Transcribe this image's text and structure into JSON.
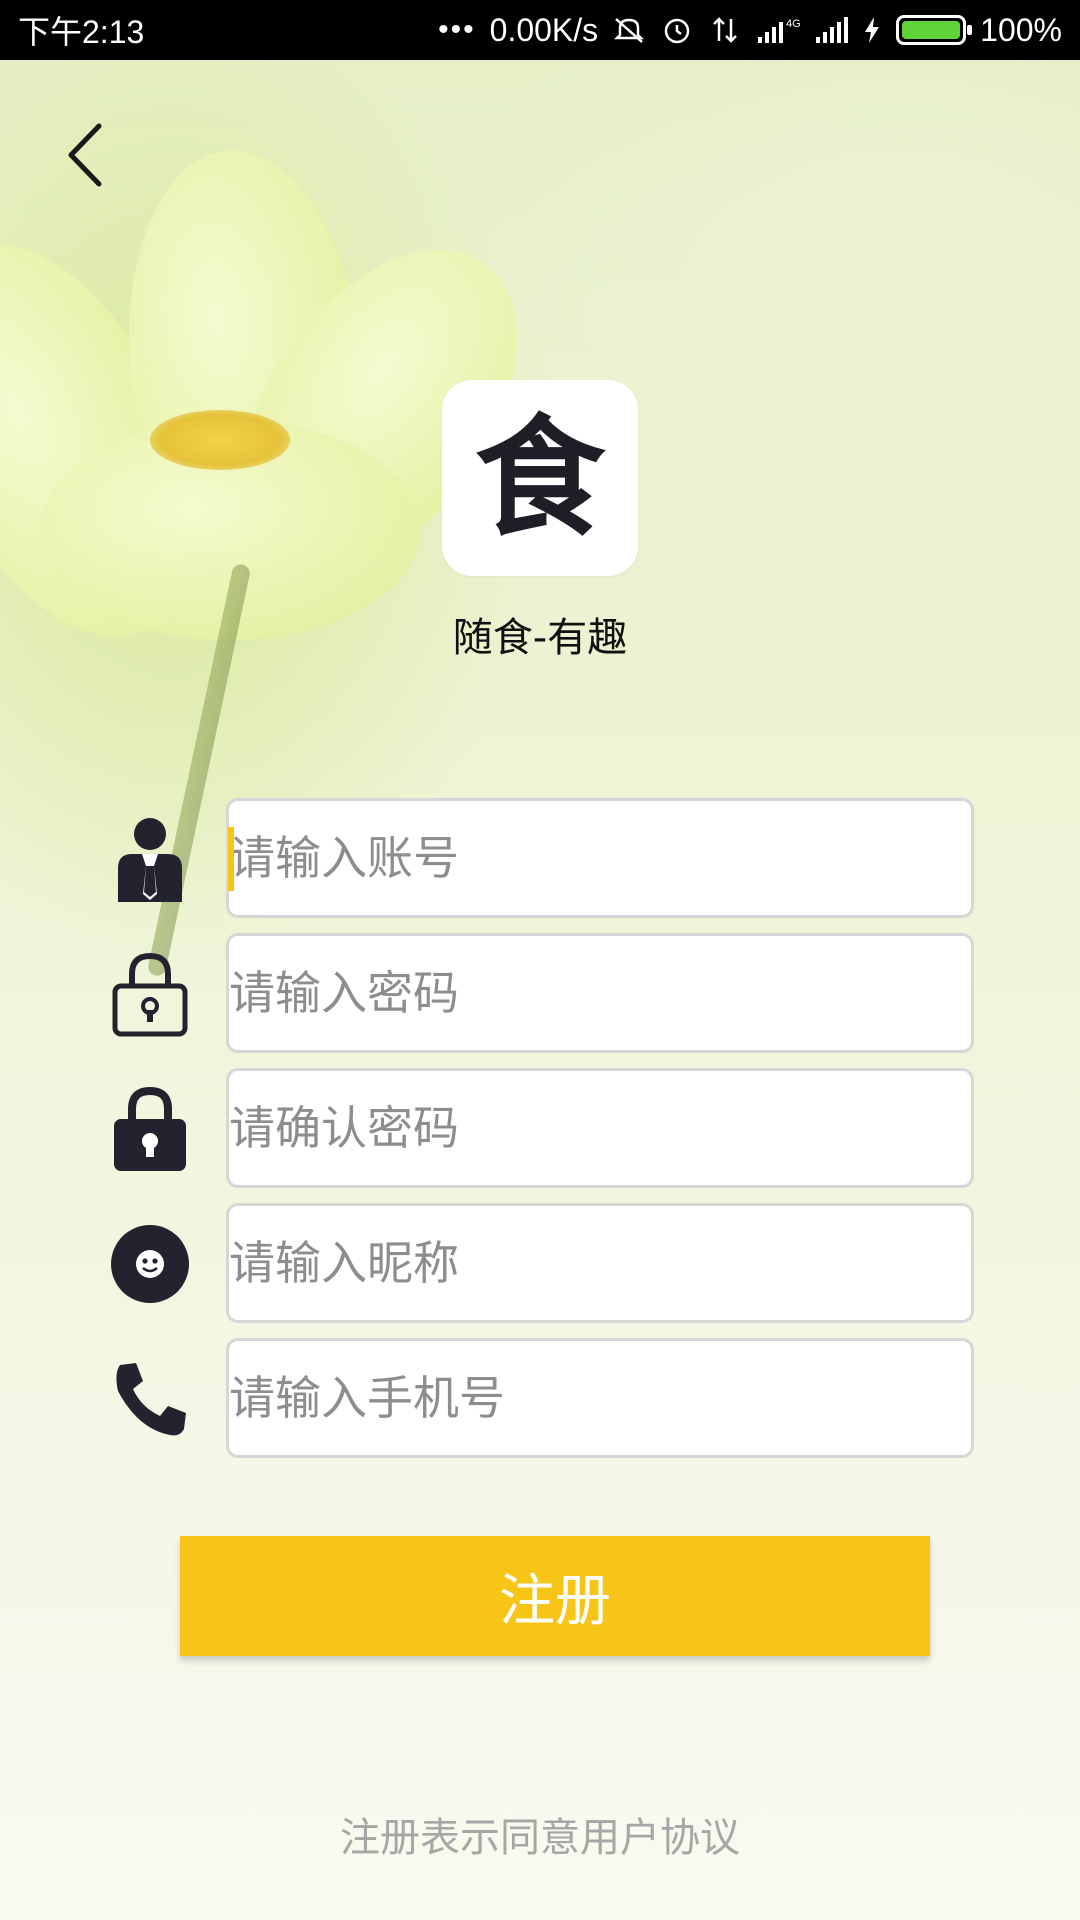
{
  "status_bar": {
    "time": "下午2:13",
    "network_speed": "0.00K/s",
    "network_type": "4G",
    "battery_percent": "100%",
    "icons": [
      "more-icon",
      "mute-icon",
      "alarm-icon",
      "data-arrows-icon",
      "signal-icon",
      "signal-icon",
      "charging-icon",
      "battery-icon"
    ]
  },
  "header": {
    "back_icon": "back-arrow-icon"
  },
  "app": {
    "logo_glyph": "食",
    "name": "随食-有趣"
  },
  "form": {
    "fields": [
      {
        "icon": "user-icon",
        "placeholder": "请输入账号"
      },
      {
        "icon": "lock-outline-icon",
        "placeholder": "请输入密码"
      },
      {
        "icon": "lock-filled-icon",
        "placeholder": "请确认密码"
      },
      {
        "icon": "smiley-icon",
        "placeholder": "请输入昵称"
      },
      {
        "icon": "phone-icon",
        "placeholder": "请输入手机号"
      }
    ],
    "submit_label": "注册"
  },
  "footer": {
    "agreement_text": "注册表示同意用户协议"
  },
  "colors": {
    "accent": "#F6C518",
    "icon_dark": "#23232f",
    "placeholder": "#8d8d8d",
    "status_bar": "#000000"
  }
}
